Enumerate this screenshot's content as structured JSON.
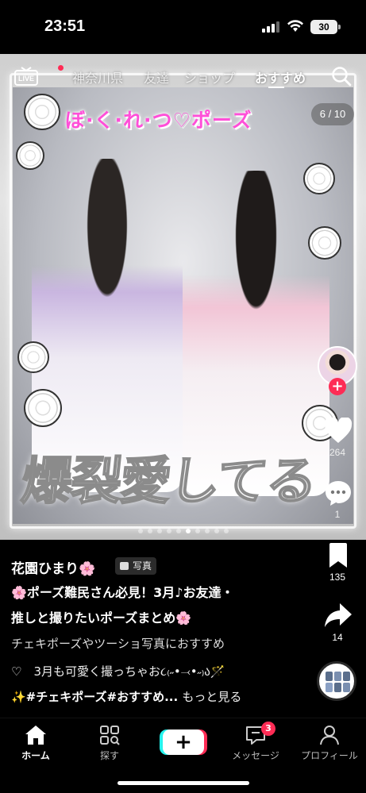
{
  "status_bar": {
    "time": "23:51",
    "battery": "30"
  },
  "top_nav": {
    "tabs": [
      {
        "label": "神奈川県"
      },
      {
        "label": "友達"
      },
      {
        "label": "ショップ"
      },
      {
        "label": "おすすめ",
        "active": true
      }
    ]
  },
  "media": {
    "page_counter": "6 / 10",
    "current_page": 6,
    "total_pages": 10,
    "overlay_title": "ぼ·く·れ·つ♡ポーズ",
    "overlay_caption": "爆裂愛してる"
  },
  "rail": {
    "like_count": "264",
    "comment_count": "1",
    "save_count": "135",
    "share_count": "14"
  },
  "post": {
    "author": "花園ひまり🌸",
    "badge": "写真",
    "title_line1": "🌸ポーズ難民さん必見！3月♪お友達・",
    "title_line2": "推しと撮りたいポーズまとめ🌸",
    "subtitle": "チェキポーズやツーショ写真におすすめ",
    "line3": "♡　3月も可愛く撮っちゃお૮₍˶•⤙•˶₎ა🪄",
    "hashtags": "✨#チェキポーズ#おすすめ...",
    "more": "もっと見る"
  },
  "bottom_nav": {
    "home": "ホーム",
    "discover": "探す",
    "create": "+",
    "messages": "メッセージ",
    "messages_badge": "3",
    "profile": "プロフィール"
  },
  "colors": {
    "accent": "#fe2c55",
    "cyan": "#25f4ee",
    "overlay_pink": "#ff4fd8"
  }
}
